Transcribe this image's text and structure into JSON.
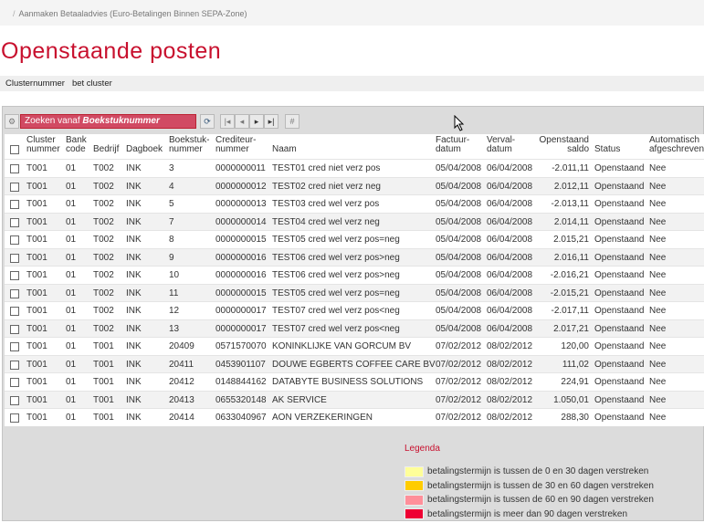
{
  "breadcrumb": {
    "items": [
      "Aanmaken Betaaladvies (Euro-Betalingen Binnen SEPA-Zone)"
    ]
  },
  "page_title": "Openstaande posten",
  "cluster": {
    "label": "Clusternummer",
    "value": "bet cluster"
  },
  "toolbar": {
    "search_prefix": "Zoeken vanaf ",
    "search_field": "Boekstuknummer",
    "icons": [
      "gear-icon",
      "refresh-icon",
      "first-page-icon",
      "prev-page-icon",
      "next-page-icon",
      "last-page-icon",
      "hash-icon"
    ]
  },
  "table": {
    "headers": [
      "Cluster nummer",
      "Bank code",
      "Bedrijf",
      "Dagboek",
      "Boekstuk- nummer",
      "Crediteur- nummer",
      "Naam",
      "Factuur- datum",
      "Verval- datum",
      "Openstaand saldo",
      "Status",
      "Automatisch afgeschreven"
    ],
    "header_lines": [
      [
        "Cluster",
        "nummer"
      ],
      [
        "Bank",
        "code"
      ],
      [
        "",
        "Bedrijf"
      ],
      [
        "",
        "Dagboek"
      ],
      [
        "Boekstuk-",
        "nummer"
      ],
      [
        "Crediteur-",
        "nummer"
      ],
      [
        "",
        "Naam"
      ],
      [
        "Factuur-",
        "datum"
      ],
      [
        "Verval-",
        "datum"
      ],
      [
        "Openstaand",
        "saldo"
      ],
      [
        "",
        "Status"
      ],
      [
        "Automatisch",
        "afgeschreven"
      ]
    ],
    "rows": [
      [
        "T001",
        "01",
        "T002",
        "INK",
        "3",
        "0000000011",
        "TEST01 cred niet verz pos",
        "05/04/2008",
        "06/04/2008",
        "-2.011,11",
        "Openstaand",
        "Nee"
      ],
      [
        "T001",
        "01",
        "T002",
        "INK",
        "4",
        "0000000012",
        "TEST02 cred niet verz neg",
        "05/04/2008",
        "06/04/2008",
        "2.012,11",
        "Openstaand",
        "Nee"
      ],
      [
        "T001",
        "01",
        "T002",
        "INK",
        "5",
        "0000000013",
        "TEST03 cred wel verz pos",
        "05/04/2008",
        "06/04/2008",
        "-2.013,11",
        "Openstaand",
        "Nee"
      ],
      [
        "T001",
        "01",
        "T002",
        "INK",
        "7",
        "0000000014",
        "TEST04 cred wel verz neg",
        "05/04/2008",
        "06/04/2008",
        "2.014,11",
        "Openstaand",
        "Nee"
      ],
      [
        "T001",
        "01",
        "T002",
        "INK",
        "8",
        "0000000015",
        "TEST05 cred wel verz pos=neg",
        "05/04/2008",
        "06/04/2008",
        "2.015,21",
        "Openstaand",
        "Nee"
      ],
      [
        "T001",
        "01",
        "T002",
        "INK",
        "9",
        "0000000016",
        "TEST06 cred wel verz pos>neg",
        "05/04/2008",
        "06/04/2008",
        "2.016,11",
        "Openstaand",
        "Nee"
      ],
      [
        "T001",
        "01",
        "T002",
        "INK",
        "10",
        "0000000016",
        "TEST06 cred wel verz pos>neg",
        "05/04/2008",
        "06/04/2008",
        "-2.016,21",
        "Openstaand",
        "Nee"
      ],
      [
        "T001",
        "01",
        "T002",
        "INK",
        "11",
        "0000000015",
        "TEST05 cred wel verz pos=neg",
        "05/04/2008",
        "06/04/2008",
        "-2.015,21",
        "Openstaand",
        "Nee"
      ],
      [
        "T001",
        "01",
        "T002",
        "INK",
        "12",
        "0000000017",
        "TEST07 cred wel verz pos<neg",
        "05/04/2008",
        "06/04/2008",
        "-2.017,11",
        "Openstaand",
        "Nee"
      ],
      [
        "T001",
        "01",
        "T002",
        "INK",
        "13",
        "0000000017",
        "TEST07 cred wel verz pos<neg",
        "05/04/2008",
        "06/04/2008",
        "2.017,21",
        "Openstaand",
        "Nee"
      ],
      [
        "T001",
        "01",
        "T001",
        "INK",
        "20409",
        "0571570070",
        "KONINKLIJKE VAN GORCUM BV",
        "07/02/2012",
        "08/02/2012",
        "120,00",
        "Openstaand",
        "Nee"
      ],
      [
        "T001",
        "01",
        "T001",
        "INK",
        "20411",
        "0453901107",
        "DOUWE EGBERTS COFFEE CARE BV",
        "07/02/2012",
        "08/02/2012",
        "111,02",
        "Openstaand",
        "Nee"
      ],
      [
        "T001",
        "01",
        "T001",
        "INK",
        "20412",
        "0148844162",
        "DATABYTE BUSINESS SOLUTIONS",
        "07/02/2012",
        "08/02/2012",
        "224,91",
        "Openstaand",
        "Nee"
      ],
      [
        "T001",
        "01",
        "T001",
        "INK",
        "20413",
        "0655320148",
        "AK SERVICE",
        "07/02/2012",
        "08/02/2012",
        "1.050,01",
        "Openstaand",
        "Nee"
      ],
      [
        "T001",
        "01",
        "T001",
        "INK",
        "20414",
        "0633040967",
        "AON VERZEKERINGEN",
        "07/02/2012",
        "08/02/2012",
        "288,30",
        "Openstaand",
        "Nee"
      ]
    ]
  },
  "legend": {
    "title": "Legenda",
    "items": [
      {
        "label": "betalingstermijn is tussen de 0 en 30 dagen verstreken",
        "color": "#ffff99"
      },
      {
        "label": "betalingstermijn is tussen de 30 en 60 dagen verstreken",
        "color": "#ffcc00"
      },
      {
        "label": "betalingstermijn is tussen de 60 en 90 dagen verstreken",
        "color": "#ff8f9a"
      },
      {
        "label": "betalingstermijn is meer dan 90 dagen verstreken",
        "color": "#ee0033"
      }
    ]
  }
}
